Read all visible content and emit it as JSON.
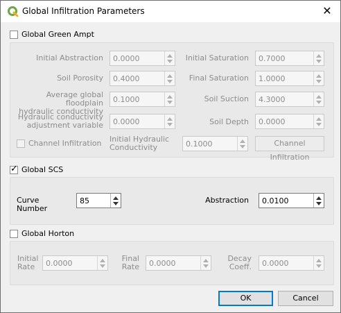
{
  "window": {
    "title": "Global Infiltration Parameters",
    "close_glyph": "✕",
    "app_icon": "qgis-icon"
  },
  "green_ampt": {
    "label": "Global Green Ampt",
    "checked": false,
    "initial_abstraction": {
      "label": "Initial Abstraction",
      "value": "0.0000"
    },
    "initial_saturation": {
      "label": "Initial Saturation",
      "value": "0.7000"
    },
    "soil_porosity": {
      "label": "Soil Porosity",
      "value": "0.4000"
    },
    "final_saturation": {
      "label": "Final Saturation",
      "value": "1.0000"
    },
    "avg_hydraulic": {
      "label_line1": "Average global floodplain",
      "label_line2": "hydraulic conductivity",
      "value": "0.1000"
    },
    "soil_suction": {
      "label": "Soil Suction",
      "value": "4.3000"
    },
    "hydraulic_adj": {
      "label_line1": "Hydraulic conductivity",
      "label_line2": "adjustment variable",
      "value": "0.0000"
    },
    "soil_depth": {
      "label": "Soil Depth",
      "value": "0.0000"
    },
    "channel_infiltration_checkbox": "Channel Infiltration",
    "initial_hydraulic": {
      "label_line1": "Initial Hydraulic",
      "label_line2": "Conductivity",
      "value": "0.1000"
    },
    "channel_infiltration_button": "Channel Infiltration"
  },
  "scs": {
    "label": "Global SCS",
    "checked": true,
    "curve_number": {
      "label": "Curve Number",
      "value": "85"
    },
    "abstraction": {
      "label": "Abstraction",
      "value": "0.0100"
    }
  },
  "horton": {
    "label": "Global Horton",
    "checked": false,
    "initial_rate": {
      "label_line1": "Initial",
      "label_line2": "Rate",
      "value": "0.0000"
    },
    "final_rate": {
      "label_line1": "Final",
      "label_line2": "Rate",
      "value": "0.0000"
    },
    "decay_coeff": {
      "label_line1": "Decay",
      "label_line2": "Coeff.",
      "value": "0.0000"
    }
  },
  "buttons": {
    "ok": "OK",
    "cancel": "Cancel"
  }
}
